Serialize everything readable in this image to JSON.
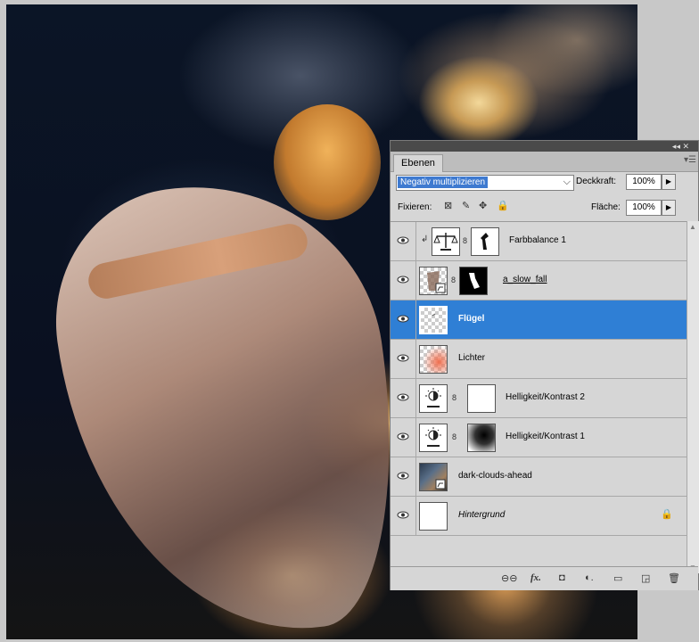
{
  "panel": {
    "tab_label": "Ebenen",
    "collapse_glyph": "◂◂ ✕",
    "menu_glyph": "▾☰"
  },
  "blend": {
    "mode": "Negativ multiplizieren",
    "opacity_label": "Deckkraft:",
    "opacity_value": "100%"
  },
  "lock": {
    "label": "Fixieren:",
    "icons": [
      "lock-transparent-icon",
      "lock-pixels-icon",
      "lock-position-icon",
      "lock-all-icon"
    ],
    "fill_label": "Fläche:",
    "fill_value": "100%"
  },
  "layers": [
    {
      "name": "Farbbalance 1",
      "type": "adjustment-color-balance",
      "visible": true,
      "selected": false,
      "clipped": true,
      "has_mask": true
    },
    {
      "name": "a_slow_fall",
      "type": "smart-object",
      "visible": true,
      "selected": false,
      "clipped": false,
      "has_mask": true
    },
    {
      "name": "Flügel",
      "type": "pixel",
      "visible": true,
      "selected": true,
      "clipped": false,
      "has_mask": false
    },
    {
      "name": "Lichter",
      "type": "pixel",
      "visible": true,
      "selected": false,
      "clipped": false,
      "has_mask": false
    },
    {
      "name": "Helligkeit/Kontrast 2",
      "type": "adjustment-brightness-contrast",
      "visible": true,
      "selected": false,
      "clipped": false,
      "has_mask": true
    },
    {
      "name": "Helligkeit/Kontrast 1",
      "type": "adjustment-brightness-contrast",
      "visible": true,
      "selected": false,
      "clipped": false,
      "has_mask": true
    },
    {
      "name": "dark-clouds-ahead",
      "type": "smart-object",
      "visible": true,
      "selected": false,
      "clipped": false,
      "has_mask": false
    },
    {
      "name": "Hintergrund",
      "type": "background",
      "visible": true,
      "selected": false,
      "clipped": false,
      "has_mask": false,
      "locked": true
    }
  ],
  "footer_icons": [
    "link-layers-icon",
    "fx-icon",
    "add-mask-icon",
    "adjustment-layer-icon",
    "new-group-icon",
    "new-layer-icon",
    "trash-icon"
  ],
  "footer_glyphs": {
    "link": "⊖⊖",
    "fx": "fx.",
    "mask": "◘",
    "adjust": "◐.",
    "group": "▭",
    "new": "◲",
    "trash": "🗑"
  },
  "colors": {
    "selection": "#2f7fd5",
    "panel_bg": "#d6d6d6",
    "blend_highlight": "#3e7ad0"
  }
}
